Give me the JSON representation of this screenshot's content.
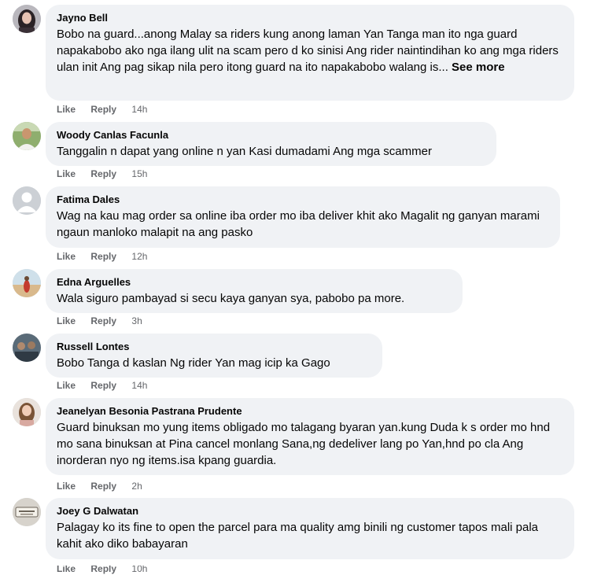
{
  "comments": [
    {
      "author": "Jayno Bell",
      "text": "Bobo na guard...anong Malay sa riders kung anong laman Yan Tanga man ito nga guard napakabobo ako nga ilang ulit na scam pero d ko sinisi Ang rider naintindihan ko ang mga riders ulan init Ang pag sikap nila pero itong guard na ito napakabobo walang is...",
      "see_more": " See more",
      "like": "Like",
      "reply": "Reply",
      "time": "14h",
      "avatar_icon": "profile-photo-dark-hair"
    },
    {
      "author": "Woody Canlas Facunla",
      "text": "Tanggalin n dapat yang online n yan Kasi dumadami Ang mga scammer",
      "like": "Like",
      "reply": "Reply",
      "time": "15h",
      "avatar_icon": "profile-photo-outdoor"
    },
    {
      "author": "Fatima Dales",
      "text": "Wag na kau mag order sa online iba order mo iba deliver khit ako Magalit ng ganyan marami ngaun manloko malapit na ang pasko",
      "like": "Like",
      "reply": "Reply",
      "time": "12h",
      "avatar_icon": "default-avatar-icon"
    },
    {
      "author": "Edna Arguelles",
      "text": "Wala siguro pambayad si secu kaya ganyan sya, pabobo pa more.",
      "like": "Like",
      "reply": "Reply",
      "time": "3h",
      "avatar_icon": "profile-photo-beach"
    },
    {
      "author": "Russell Lontes",
      "text": "Bobo Tanga d kaslan Ng rider Yan mag icip ka Gago",
      "like": "Like",
      "reply": "Reply",
      "time": "14h",
      "avatar_icon": "profile-photo-group"
    },
    {
      "author": "Jeanelyan Besonia Pastrana Prudente",
      "text": "Guard binuksan mo yung items obligado mo talagang byaran yan.kung Duda k s order mo hnd mo sana binuksan at Pina cancel monlang Sana,ng dedeliver lang po Yan,hnd po cla Ang inorderan nyo ng items.isa kpang guardia.",
      "like": "Like",
      "reply": "Reply",
      "time": "2h",
      "avatar_icon": "profile-photo-woman"
    },
    {
      "author": "Joey G Dalwatan",
      "text": "Palagay ko its fine to open the parcel para ma quality amg binili ng customer tapos mali pala kahit ako diko babayaran",
      "like": "Like",
      "reply": "Reply",
      "time": "10h",
      "avatar_icon": "profile-photo-sign"
    }
  ],
  "colors": {
    "bubble_bg": "#f0f2f5",
    "text": "#050505",
    "secondary": "#65676b"
  }
}
